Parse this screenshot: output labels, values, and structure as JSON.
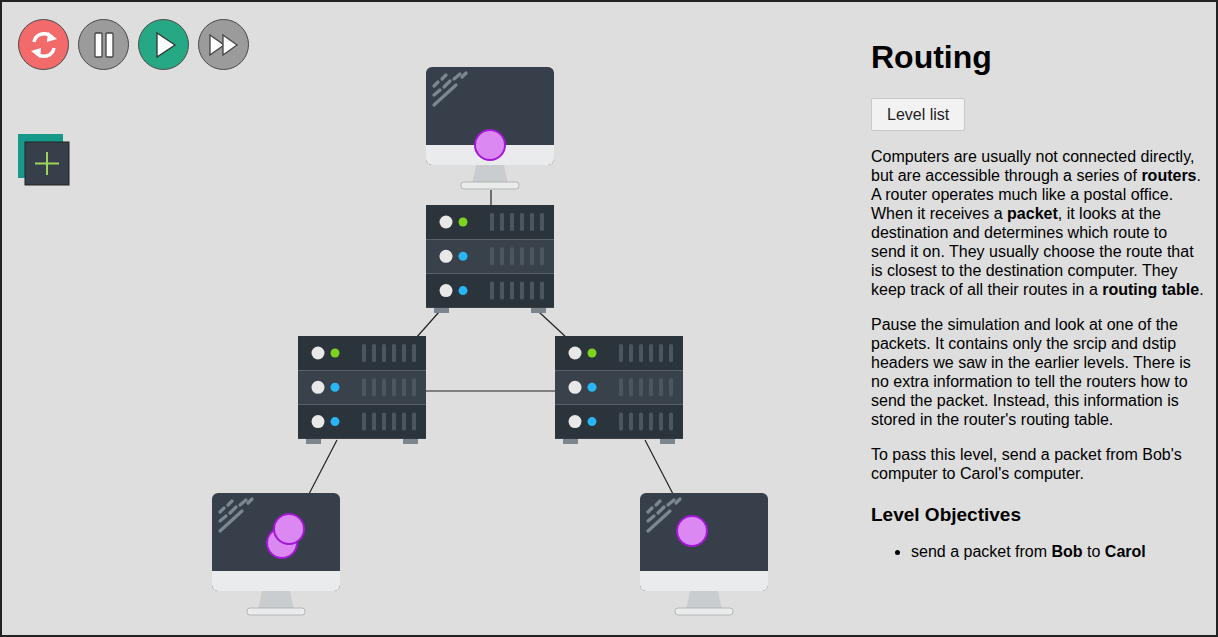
{
  "controls": [
    {
      "kind": "restart",
      "color": "#f26a6a"
    },
    {
      "kind": "pause",
      "color": "#9b9b9b"
    },
    {
      "kind": "play",
      "color": "#26a884"
    },
    {
      "kind": "fast-forward",
      "color": "#9b9b9b"
    }
  ],
  "network": {
    "nodes": [
      {
        "kind": "computer",
        "packets": 1
      },
      {
        "kind": "router",
        "packets": 0
      },
      {
        "kind": "router",
        "packets": 0
      },
      {
        "kind": "router",
        "packets": 0
      },
      {
        "kind": "computer",
        "packets": 2
      },
      {
        "kind": "computer",
        "packets": 1
      }
    ]
  },
  "panel": {
    "title": "Routing",
    "buttons": [
      "Level list"
    ],
    "paragraphs": [
      {
        "segments": [
          {
            "text": "Computers are usually not connected directly, but are accessible through a series of ",
            "bold": false
          },
          {
            "text": "routers",
            "bold": true
          },
          {
            "text": ". A router operates much like a postal office. When it receives a ",
            "bold": false
          },
          {
            "text": "packet",
            "bold": true
          },
          {
            "text": ", it looks at the destination and determines which route to send it on. They usually choose the route that is closest to the destination computer. They keep track of all their routes in a ",
            "bold": false
          },
          {
            "text": "routing table",
            "bold": true
          },
          {
            "text": ".",
            "bold": false
          }
        ]
      },
      {
        "segments": [
          {
            "text": "Pause the simulation and look at one of the packets. It contains only the srcip and dstip headers we saw in the earlier levels. There is no extra information to tell the routers how to send the packet. Instead, this information is stored in the router's routing table.",
            "bold": false
          }
        ]
      },
      {
        "segments": [
          {
            "text": "To pass this level, send a packet from Bob's computer to Carol's computer.",
            "bold": false
          }
        ]
      }
    ],
    "objectives_heading": "Level Objectives",
    "objectives": [
      {
        "segments": [
          {
            "text": "send a packet from ",
            "bold": false
          },
          {
            "text": "Bob",
            "bold": true
          },
          {
            "text": " to ",
            "bold": false
          },
          {
            "text": "Carol",
            "bold": true
          }
        ]
      }
    ]
  }
}
